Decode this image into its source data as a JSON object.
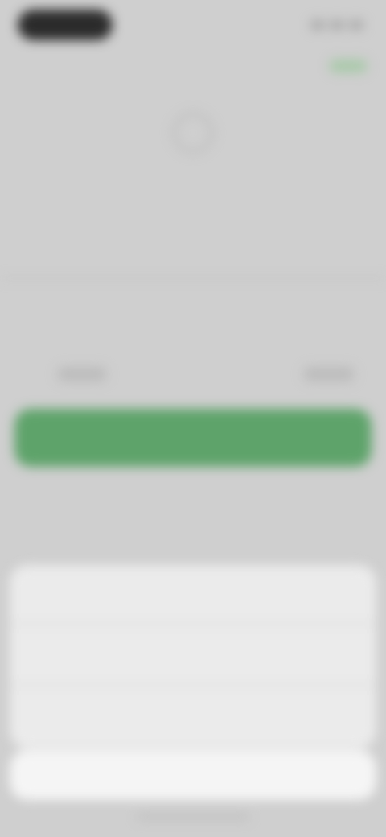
{
  "colors": {
    "background": "#cfcfcf",
    "primary_button": "#5ea36a",
    "sheet_option_text": "#4f86d6",
    "sheet_background": "#ebebeb"
  },
  "icons": {
    "header_icon": "circle-icon"
  }
}
